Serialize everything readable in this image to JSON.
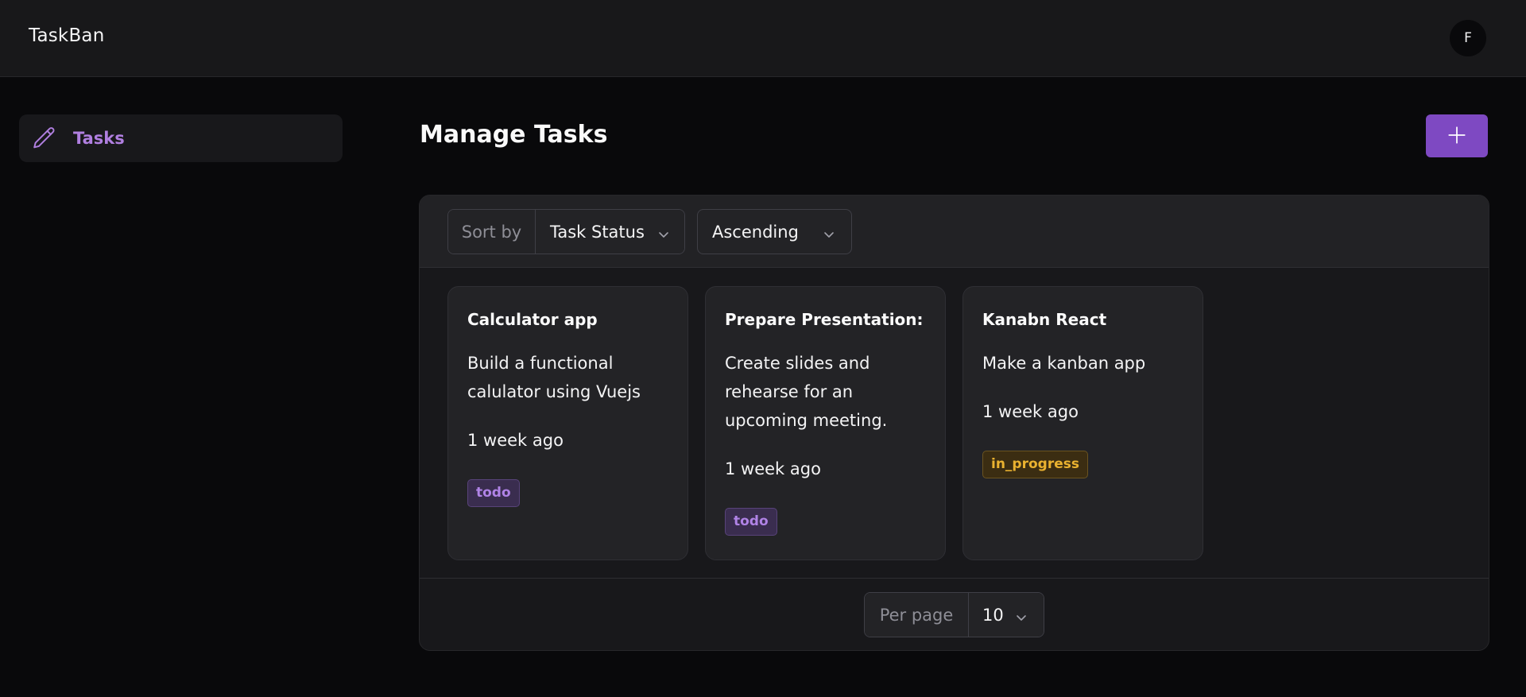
{
  "app": {
    "brand": "TaskBan",
    "user_initial": "F"
  },
  "sidebar": {
    "items": [
      {
        "label": "Tasks",
        "icon": "pencil-icon",
        "active": true
      }
    ]
  },
  "main": {
    "title": "Manage Tasks",
    "add_icon": "plus-icon"
  },
  "toolbar": {
    "sort_prefix": "Sort by",
    "sort_value": "Task Status",
    "order_value": "Ascending"
  },
  "tasks": [
    {
      "title": "Calculator app",
      "description": "Build a functional calulator using Vuejs",
      "time": "1 week ago",
      "status": "todo"
    },
    {
      "title": "Prepare Presentation:",
      "description": "Create slides and rehearse for an upcoming meeting.",
      "time": "1 week ago",
      "status": "todo"
    },
    {
      "title": "Kanabn React",
      "description": "Make a kanban app",
      "time": "1 week ago",
      "status": "in_progress"
    }
  ],
  "pagination": {
    "per_page_prefix": "Per page",
    "per_page_value": "10"
  },
  "colors": {
    "accent": "#7e49c2",
    "accent_text": "#b07fe0",
    "todo_badge": "#b083e6",
    "in_progress_badge": "#eab230",
    "background": "#09090b",
    "panel": "#18181b"
  }
}
